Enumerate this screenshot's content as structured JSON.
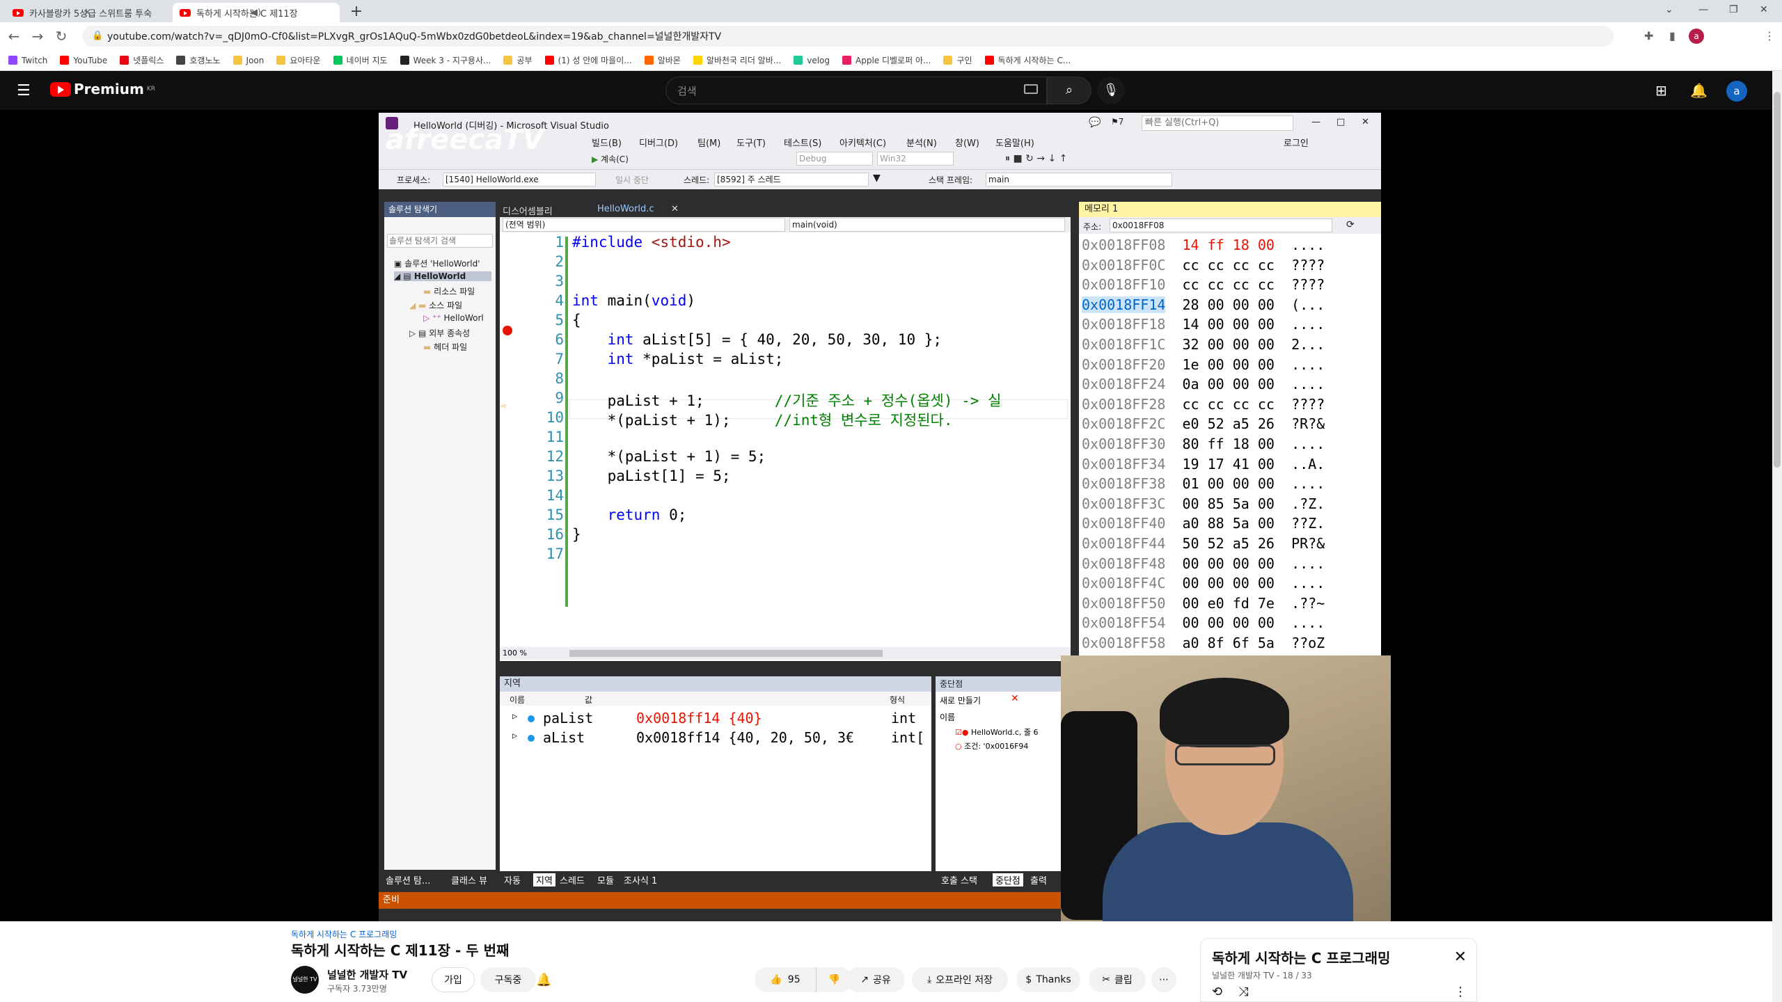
{
  "browser": {
    "tabs": [
      {
        "title": "카사블랑카 5성급 스위트룸 투숙"
      },
      {
        "title": "독하게 시작하는 C 제11장"
      }
    ],
    "url": "youtube.com/watch?v=_qDJ0mO-Cf0&list=PLXvgR_grOs1AQuQ-5mWbx0zdG0betdeoL&index=19&ab_channel=널널한개발자TV",
    "bookmarks": [
      "Twitch",
      "YouTube",
      "넷플릭스",
      "호갱노노",
      "Joon",
      "요아타운",
      "네이버 지도",
      "Week 3 - 지구용사...",
      "공부",
      "(1) 성 안에 마을이...",
      "알바몬",
      "알바천국 리더 알바...",
      "velog",
      "Apple 디벨로퍼 아...",
      "구인",
      "독하게 시작하는 C..."
    ]
  },
  "youtube": {
    "logo": "Premium",
    "logo_region": "KR",
    "search_placeholder": "검색",
    "avatar_letter": "a"
  },
  "vs": {
    "window_title": "HelloWorld (디버깅) - Microsoft Visual Studio",
    "quick_launch": "빠른 실행(Ctrl+Q)",
    "login": "로그인",
    "menu": [
      "빌드(B)",
      "디버그(D)",
      "팀(M)",
      "도구(T)",
      "테스트(S)",
      "아키텍처(C)",
      "분석(N)",
      "창(W)",
      "도움말(H)"
    ],
    "continue_label": "계속(C)",
    "config": "Debug",
    "platform": "Win32",
    "process_label": "프로세스:",
    "process": "[1540] HelloWorld.exe",
    "suspend": "일시 중단",
    "thread_label": "스레드:",
    "thread": "[8592] 주 스레드",
    "stack_label": "스택 프레임:",
    "stack": "main",
    "solution_explorer": {
      "title": "솔루션 탐색기",
      "search": "솔루션 탐색기 검색",
      "items": [
        "솔루션 'HelloWorld'",
        "HelloWorld",
        "리소스 파일",
        "소스 파일",
        "HelloWorl",
        "외부 종속성",
        "헤더 파일"
      ]
    },
    "editor": {
      "tab_disasm": "디스어셈블리",
      "tab_file": "HelloWorld.c",
      "scope": "(전역 범위)",
      "func": "main(void)",
      "zoom": "100 %",
      "lines": [
        {
          "n": "1",
          "code": "#include <stdio.h>"
        },
        {
          "n": "2",
          "code": ""
        },
        {
          "n": "3",
          "code": ""
        },
        {
          "n": "4",
          "code": "int main(void)"
        },
        {
          "n": "5",
          "code": "{"
        },
        {
          "n": "6",
          "code": "    int aList[5] = { 40, 20, 50, 30, 10 };"
        },
        {
          "n": "7",
          "code": "    int *paList = aList;"
        },
        {
          "n": "8",
          "code": ""
        },
        {
          "n": "9",
          "code": "    paList + 1;        //기준 주소 + 정수(옵셋) -> 실"
        },
        {
          "n": "10",
          "code": "    *(paList + 1);     //int형 변수로 지정된다."
        },
        {
          "n": "11",
          "code": ""
        },
        {
          "n": "12",
          "code": "    *(paList + 1) = 5;"
        },
        {
          "n": "13",
          "code": "    paList[1] = 5;"
        },
        {
          "n": "14",
          "code": ""
        },
        {
          "n": "15",
          "code": "    return 0;"
        },
        {
          "n": "16",
          "code": "}"
        },
        {
          "n": "17",
          "code": ""
        }
      ]
    },
    "memory": {
      "title": "메모리 1",
      "addr_label": "주소:",
      "addr": "0x0018FF08",
      "rows": [
        [
          "0x0018FF08",
          "14 ff 18 00",
          "...."
        ],
        [
          "0x0018FF0C",
          "cc cc cc cc",
          "????"
        ],
        [
          "0x0018FF10",
          "cc cc cc cc",
          "????"
        ],
        [
          "0x0018FF14",
          "28 00 00 00",
          "(..."
        ],
        [
          "0x0018FF18",
          "14 00 00 00",
          "...."
        ],
        [
          "0x0018FF1C",
          "32 00 00 00",
          "2..."
        ],
        [
          "0x0018FF20",
          "1e 00 00 00",
          "...."
        ],
        [
          "0x0018FF24",
          "0a 00 00 00",
          "...."
        ],
        [
          "0x0018FF28",
          "cc cc cc cc",
          "????"
        ],
        [
          "0x0018FF2C",
          "e0 52 a5 26",
          "?R?&"
        ],
        [
          "0x0018FF30",
          "80 ff 18 00",
          "...."
        ],
        [
          "0x0018FF34",
          "19 17 41 00",
          "..A."
        ],
        [
          "0x0018FF38",
          "01 00 00 00",
          "...."
        ],
        [
          "0x0018FF3C",
          "00 85 5a 00",
          ".?Z."
        ],
        [
          "0x0018FF40",
          "a0 88 5a 00",
          "??Z."
        ],
        [
          "0x0018FF44",
          "50 52 a5 26",
          "PR?&"
        ],
        [
          "0x0018FF48",
          "00 00 00 00",
          "...."
        ],
        [
          "0x0018FF4C",
          "00 00 00 00",
          "...."
        ],
        [
          "0x0018FF50",
          "00 e0 fd 7e",
          ".??~"
        ],
        [
          "0x0018FF54",
          "00 00 00 00",
          "...."
        ],
        [
          "0x0018FF58",
          "a0 8f 6f 5a",
          "??oZ"
        ]
      ]
    },
    "locals": {
      "title": "지역",
      "col_name": "이름",
      "col_value": "값",
      "col_type": "형식",
      "rows": [
        {
          "name": "paList",
          "value": "0x0018ff14 {40}",
          "type": "int"
        },
        {
          "name": "aList",
          "value": "0x0018ff14 {40, 20, 50, 3€",
          "type": "int["
        }
      ]
    },
    "breakpoints": {
      "title": "중단점",
      "new": "새로 만들기",
      "col_name": "이름",
      "item": "HelloWorld.c, 줄 6",
      "condition": "조건: '0x0016F94"
    },
    "bottom_tabs": [
      "솔루션 탐...",
      "클래스 뷰",
      "자동",
      "지역",
      "스레드",
      "모듈",
      "조사식 1",
      "호출 스택",
      "중단점",
      "출력"
    ],
    "status": "준비"
  },
  "watermark": "afreecaTV",
  "video": {
    "playlist": "독하게 시작하는 C 프로그래밍",
    "title": "독하게 시작하는 C 제11장 - 두 번째",
    "channel_avatar_text": "널널한 TV",
    "channel": "널널한 개발자 TV",
    "subscribers": "구독자 3.73만명",
    "join": "가입",
    "subscribed": "구독중",
    "likes": "95",
    "share": "공유",
    "download": "오프라인 저장",
    "thanks": "Thanks",
    "clip": "클립"
  },
  "playlist_card": {
    "title": "독하게 시작하는 C 프로그래밍",
    "sub": "널널한 개발자 TV - 18 / 33"
  }
}
